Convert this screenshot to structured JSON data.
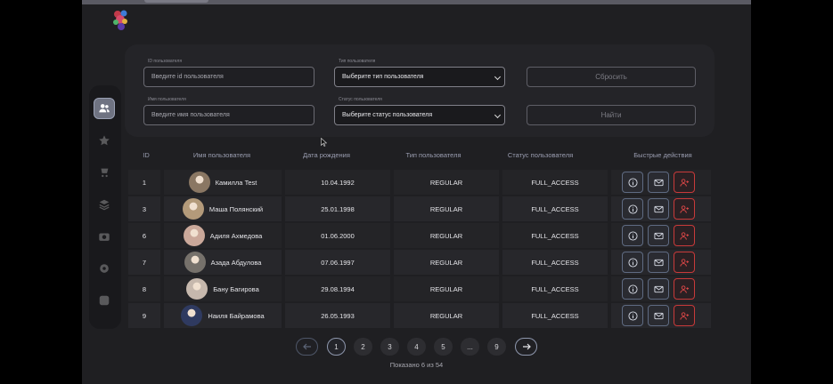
{
  "filters": {
    "id_label": "ID пользователя",
    "id_placeholder": "Введите id пользователя",
    "type_label": "Тип пользователя",
    "type_value": "Выберите тип пользователя",
    "reset_label": "Сбросить",
    "name_label": "Имя пользователя",
    "name_placeholder": "Введите имя пользователя",
    "status_label": "Статус пользователя",
    "status_value": "Выберите статус пользователя",
    "find_label": "Найти"
  },
  "table": {
    "headers": {
      "id": "ID",
      "name": "Имя пользователя",
      "birth": "Дата рождения",
      "type": "Тип пользователя",
      "status": "Статус пользователя",
      "actions": "Быстрые действия"
    },
    "rows": [
      {
        "id": "1",
        "name": "Камилла Test",
        "birth": "10.04.1992",
        "type": "REGULAR",
        "status": "FULL_ACCESS",
        "avatar_color": "#8a7763"
      },
      {
        "id": "3",
        "name": "Маша Полянский",
        "birth": "25.01.1998",
        "type": "REGULAR",
        "status": "FULL_ACCESS",
        "avatar_color": "#b39a7a"
      },
      {
        "id": "6",
        "name": "Адиля Ахмедова",
        "birth": "01.06.2000",
        "type": "REGULAR",
        "status": "FULL_ACCESS",
        "avatar_color": "#caa89a"
      },
      {
        "id": "7",
        "name": "Азада Абдулова",
        "birth": "07.06.1997",
        "type": "REGULAR",
        "status": "FULL_ACCESS",
        "avatar_color": "#76716b"
      },
      {
        "id": "8",
        "name": "Бану Багирова",
        "birth": "29.08.1994",
        "type": "REGULAR",
        "status": "FULL_ACCESS",
        "avatar_color": "#c6b8ad"
      },
      {
        "id": "9",
        "name": "Наиля Байрамова",
        "birth": "26.05.1993",
        "type": "REGULAR",
        "status": "FULL_ACCESS",
        "avatar_color": "#2f3a60"
      }
    ]
  },
  "pagination": {
    "pages": [
      "1",
      "2",
      "3",
      "4",
      "5",
      "...",
      "9"
    ],
    "current": "1",
    "prev_icon": "arrow-left-icon",
    "next_icon": "arrow-right-icon",
    "summary": "Показано 6 из 54"
  },
  "sidebar": {
    "items": [
      "users-icon",
      "star-icon",
      "cart-icon",
      "layers-icon",
      "camera-icon",
      "gear-icon",
      "logout-icon"
    ]
  },
  "colors": {
    "accent": "#8e97ad",
    "danger": "#c83a3a",
    "panel": "#242428",
    "background": "#1f1f22"
  }
}
